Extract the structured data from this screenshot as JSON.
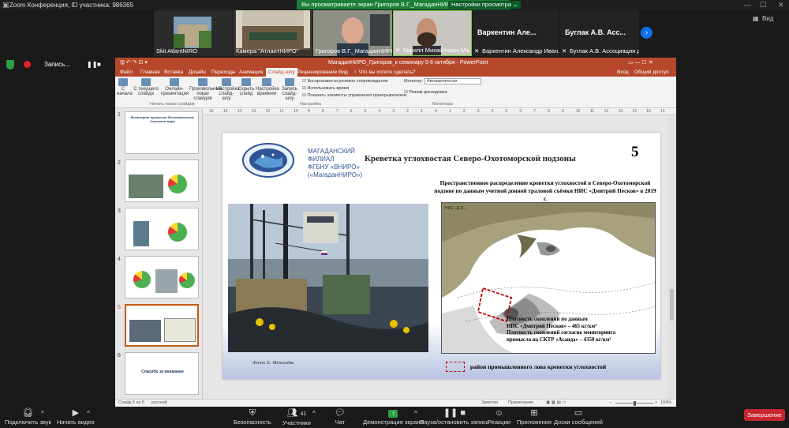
{
  "zoom": {
    "title": "Zoom Конференция, ID участника: 986365",
    "share_banner": "Вы просматриваете экран Григоров В.Г._МагаданНИРО",
    "view_options": "Настройки просмотра ⌄",
    "side_view": "Вид",
    "recording_label": "Запись...",
    "participants": [
      {
        "name": "Skit AtlantNIRO",
        "kind": "image"
      },
      {
        "name": "Камера \"АтлантНИРО\"",
        "kind": "image"
      },
      {
        "name": "Григоров В.Г._МагаданНИРО",
        "kind": "video"
      },
      {
        "name": "Кирилл Михайлович Ма...",
        "kind": "video"
      },
      {
        "name": "Варкентин Але...",
        "sub": "Варкентин Александр Иван...",
        "kind": "name"
      },
      {
        "name": "Буглак А.В. Асс...",
        "sub": "Буглак А.В. Ассоциация до...",
        "kind": "name"
      }
    ],
    "toolbar": {
      "audio": "Подключить звук",
      "video": "Начать видео",
      "security": "Безопасность",
      "participants": "Участники",
      "participants_count": "41",
      "chat": "Чат",
      "share": "Демонстрация экрана",
      "pause_rec": "Пауза/остановить запись",
      "reactions": "Реакции",
      "apps": "Приложения",
      "whiteboard": "Доски сообщений",
      "end": "Завершение"
    }
  },
  "powerpoint": {
    "window_title": "МагаданНИРО_Григоров_к семинару 5-6 октября - PowerPoint",
    "tabs": [
      "Файл",
      "Главная",
      "Вставка",
      "Дизайн",
      "Переходы",
      "Анимация",
      "Слайд-шоу",
      "Рецензирование",
      "Вид"
    ],
    "active_tab": "Слайд-шоу",
    "tell_me": "♀ Что вы хотите сделать?",
    "signin": "Вход",
    "share": "Общий доступ",
    "ribbon": {
      "from_start": "С начала",
      "from_current": "С текущего слайда",
      "online": "Онлайн-презентация",
      "custom": "Произвольный показ слайдов",
      "group_start": "Начать показ слайдов",
      "setup": "Настройка слайд-шоу",
      "hide": "Скрыть слайд",
      "rehearse": "Настройка времени",
      "record": "Запись слайд-шоу",
      "chk_narration": "Воспроизвести речевое сопровождение",
      "chk_timings": "Использовать время",
      "chk_controls": "Показать элементы управления проигрывателем",
      "group_setup": "Настройка",
      "monitor_label": "Монитор:",
      "monitor_value": "Автоматически",
      "presenter_view": "Режим докладчика",
      "group_monitors": "Мониторы"
    },
    "thumbnails": [
      {
        "num": "1",
        "title": "Мониторинг промысла беспозвоночных Охотского моря"
      },
      {
        "num": "2",
        "title": ""
      },
      {
        "num": "3",
        "title": ""
      },
      {
        "num": "4",
        "title": ""
      },
      {
        "num": "5",
        "title": ""
      },
      {
        "num": "6",
        "title": "Спасибо за внимание"
      }
    ],
    "selected_slide": 5,
    "ruler_marks": [
      "16",
      "15",
      "14",
      "13",
      "12",
      "11",
      "10",
      "9",
      "8",
      "7",
      "6",
      "5",
      "4",
      "3",
      "2",
      "1",
      "0",
      "1",
      "2",
      "3",
      "4",
      "5",
      "6",
      "7",
      "8",
      "9",
      "10",
      "11",
      "12",
      "13",
      "14",
      "15",
      "16"
    ],
    "status": {
      "slide": "Слайд 5 из 6",
      "lang": "русский",
      "notes": "Заметки",
      "comments": "Примечания",
      "zoom": "104%"
    }
  },
  "slide": {
    "org_lines": [
      "МАГАДАНСКИЙ",
      "ФИЛИАЛ",
      "ФГБНУ «ВНИРО»",
      "(«МагаданНИРО»)"
    ],
    "title": "Креветка углохвостая Северо-Охотоморской подзоны",
    "number": "5",
    "subtitle": "Пространственное распределение креветки углохвостой в Северо-Охотоморской подзоне по данным учетной донной траловой съёмки НИС «Дмитрий Песков» в 2019 г.",
    "photo_credit": "Фото Е. Метелёва",
    "map_label": "НИС «Д.П...",
    "map_note": [
      "Плотность скоплений по данным",
      "НИС «Дмитрий Песков» – 465 кг/км²",
      "Плотность скоплений согласно мониторинга",
      "промысла на СКТР «Асанда» – 4350 кг/км²"
    ],
    "legend": "район промышленного лова креветки углохвостой"
  }
}
